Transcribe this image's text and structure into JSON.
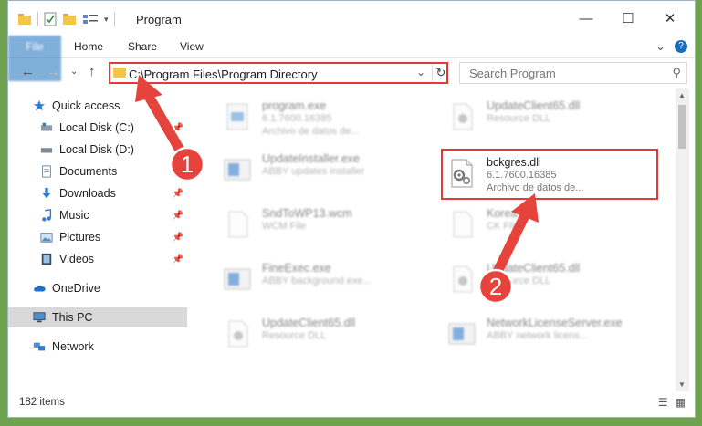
{
  "window": {
    "title": "Program",
    "controls": {
      "minimize": "—",
      "maximize": "☐",
      "close": "✕"
    }
  },
  "ribbon": {
    "tabs": [
      "File",
      "Home",
      "Share",
      "View"
    ],
    "expand_glyph": "⌄",
    "help_glyph": "?"
  },
  "address": {
    "path": "C:\\Program Files\\Program Directory",
    "back": "←",
    "forward": "→",
    "recent": "⌄",
    "up": "↑",
    "dropdown": "⌄",
    "refresh": "↻"
  },
  "search": {
    "placeholder": "Search Program",
    "icon": "⚲"
  },
  "sidebar": {
    "items": [
      {
        "label": "Quick access",
        "icon": "star-icon",
        "pinned": false
      },
      {
        "label": "Local Disk (C:)",
        "icon": "drive-icon",
        "pinned": true
      },
      {
        "label": "Local Disk (D:)",
        "icon": "drive-icon",
        "pinned": true
      },
      {
        "label": "Documents",
        "icon": "documents-icon",
        "pinned": true
      },
      {
        "label": "Downloads",
        "icon": "downloads-icon",
        "pinned": true
      },
      {
        "label": "Music",
        "icon": "music-icon",
        "pinned": true
      },
      {
        "label": "Pictures",
        "icon": "pictures-icon",
        "pinned": true
      },
      {
        "label": "Videos",
        "icon": "videos-icon",
        "pinned": true
      },
      {
        "label": "OneDrive",
        "icon": "cloud-icon",
        "pinned": false
      },
      {
        "label": "This PC",
        "icon": "computer-icon",
        "pinned": false,
        "selected": true
      },
      {
        "label": "Network",
        "icon": "network-icon",
        "pinned": false
      }
    ],
    "pin_glyph": "📌"
  },
  "files": [
    {
      "name": "program.exe",
      "line2": "6.1.7600.16385",
      "line3": "Archivo de datos de...",
      "icon": "exe-icon"
    },
    {
      "name": "UpdateClient65.dll",
      "line2": "Resource DLL",
      "line3": "",
      "icon": "dll-icon"
    },
    {
      "name": "UpdateInstaller.exe",
      "line2": "ABBY updates installer",
      "line3": "",
      "icon": "window-icon"
    },
    {
      "name": "bckgres.dll",
      "line2": "6.1.7600.16385",
      "line3": "Archivo de datos de...",
      "icon": "dll-gear-icon",
      "highlighted": true
    },
    {
      "name": "SndToWP13.wcm",
      "line2": "WCM File",
      "line3": "",
      "icon": "blank-file-icon"
    },
    {
      "name": "Korea.c",
      "line2": "CK File",
      "line3": "",
      "icon": "blank-file-icon"
    },
    {
      "name": "FineExec.exe",
      "line2": "ABBY background exe...",
      "line3": "",
      "icon": "window-icon"
    },
    {
      "name": "UpdateClient65.dll",
      "line2": "Resource DLL",
      "line3": "",
      "icon": "dll-icon"
    },
    {
      "name": "UpdateClient65.dll",
      "line2": "Resource DLL",
      "line3": "",
      "icon": "dll-icon"
    },
    {
      "name": "NetworkLicenseServer.exe",
      "line2": "ABBY network licens...",
      "line3": "",
      "icon": "window-icon"
    }
  ],
  "annotations": {
    "step1": "1",
    "step2": "2",
    "color": "#e5433c"
  },
  "status": {
    "item_count": "182 items"
  },
  "colors": {
    "accent": "#1a6fbd",
    "highlight": "#e23a3a",
    "folder": "#f3c64a"
  }
}
